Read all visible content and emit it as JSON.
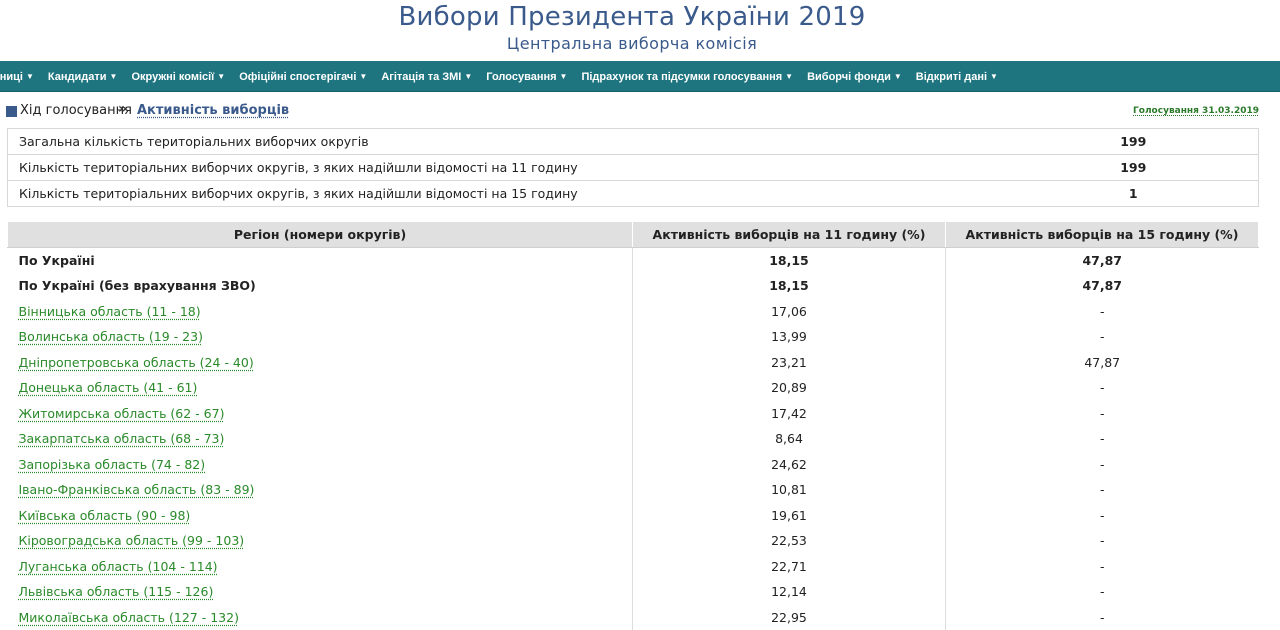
{
  "header": {
    "title": "Вибори Президента України 2019",
    "subtitle": "Центральна виборча комісія"
  },
  "nav": {
    "items": [
      "льниці",
      "Кандидати",
      "Окружні комісії",
      "Офіційні спостерігачі",
      "Агітація та ЗМІ",
      "Голосування",
      "Підрахунок та підсумки голосування",
      "Виборчі фонди",
      "Відкриті дані"
    ],
    "caret": "▼"
  },
  "breadcrumb": {
    "home": "Хід голосування",
    "separator": "»",
    "current": "Активність виборців",
    "date_link": "Голосування 31.03.2019"
  },
  "summary": [
    {
      "label": "Загальна кількість територіальних виборчих округів",
      "value": "199"
    },
    {
      "label": "Кількість територіальних виборчих округів, з яких надійшли відомості на 11 годину",
      "value": "199"
    },
    {
      "label": "Кількість територіальних виборчих округів, з яких надійшли відомості на 15 годину",
      "value": "1"
    }
  ],
  "table": {
    "headers": [
      "Регіон (номери округів)",
      "Активність виборців на 11 годину (%)",
      "Активність виборців на 15 годину (%)"
    ],
    "totals": [
      {
        "region": "По Україні",
        "h11": "18,15",
        "h15": "47,87"
      },
      {
        "region": "По Україні (без врахування ЗВО)",
        "h11": "18,15",
        "h15": "47,87"
      }
    ],
    "rows": [
      {
        "region": "Вінницька область (11 - 18)",
        "h11": "17,06",
        "h15": "-"
      },
      {
        "region": "Волинська область (19 - 23)",
        "h11": "13,99",
        "h15": "-"
      },
      {
        "region": "Дніпропетровська область (24 - 40)",
        "h11": "23,21",
        "h15": "47,87"
      },
      {
        "region": "Донецька область (41 - 61)",
        "h11": "20,89",
        "h15": "-"
      },
      {
        "region": "Житомирська область (62 - 67)",
        "h11": "17,42",
        "h15": "-"
      },
      {
        "region": "Закарпатська область (68 - 73)",
        "h11": "8,64",
        "h15": "-"
      },
      {
        "region": "Запорізька область (74 - 82)",
        "h11": "24,62",
        "h15": "-"
      },
      {
        "region": "Івано-Франківська область (83 - 89)",
        "h11": "10,81",
        "h15": "-"
      },
      {
        "region": "Київська область (90 - 98)",
        "h11": "19,61",
        "h15": "-"
      },
      {
        "region": "Кіровоградська область (99 - 103)",
        "h11": "22,53",
        "h15": "-"
      },
      {
        "region": "Луганська область (104 - 114)",
        "h11": "22,71",
        "h15": "-"
      },
      {
        "region": "Львівська область (115 - 126)",
        "h11": "12,14",
        "h15": "-"
      },
      {
        "region": "Миколаївська область (127 - 132)",
        "h11": "22,95",
        "h15": "-"
      }
    ]
  },
  "colors": {
    "navbar": "#1e7580",
    "title": "#3a5a8c",
    "link_green": "#2a8a2a",
    "header_row": "#e0e0e0"
  }
}
